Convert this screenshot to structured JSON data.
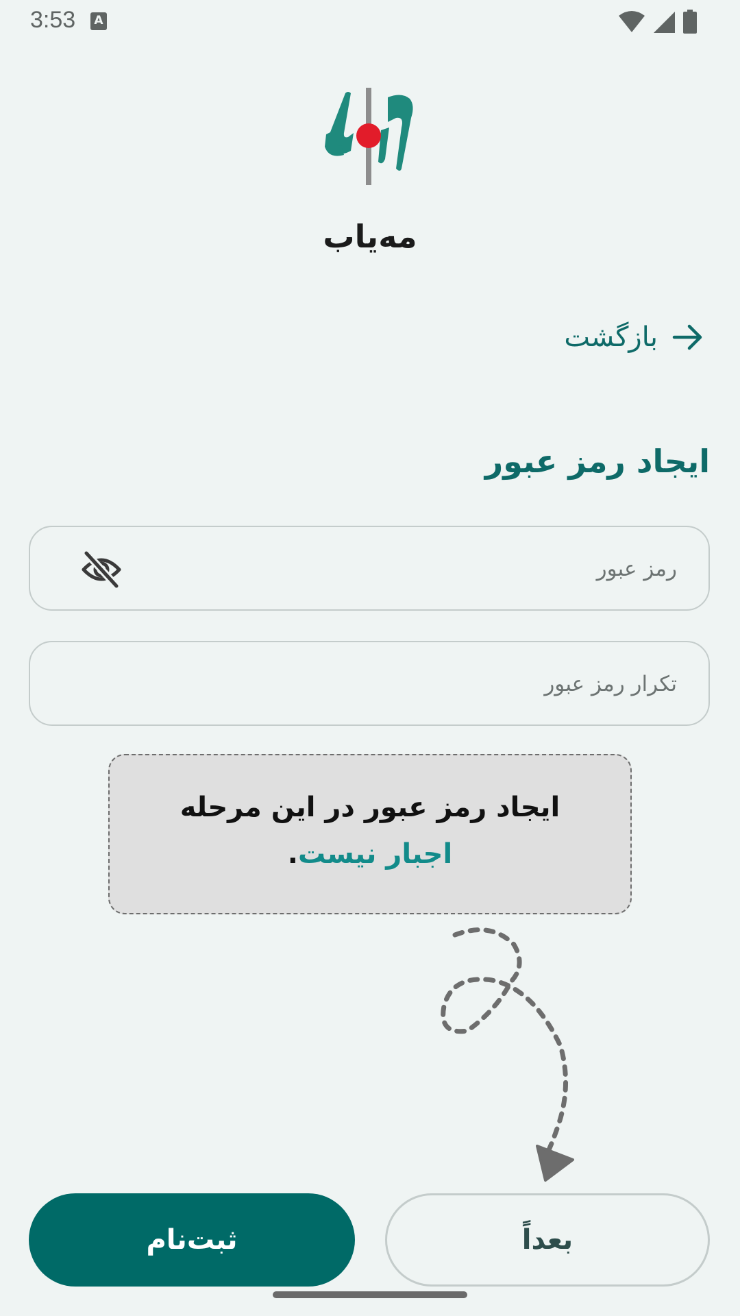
{
  "status_bar": {
    "time": "3:53",
    "notification_icon_letter": "A",
    "icons": [
      "wifi-icon",
      "cellular-signal-icon",
      "battery-icon"
    ]
  },
  "brand": {
    "app_name": "مه‌یاب",
    "logo_icon": "mahyab-logo",
    "colors": {
      "teal": "#1f8a7d",
      "red": "#e21c2a",
      "gray": "#8d8d8d"
    }
  },
  "nav": {
    "back_label": "بازگشت",
    "back_icon": "arrow-right-icon"
  },
  "form": {
    "title": "ایجاد رمز عبور",
    "password_placeholder": "رمز عبور",
    "password_toggle_icon": "eye-off-icon",
    "repeat_placeholder": "تکرار رمز عبور"
  },
  "notice": {
    "line1": "ایجاد رمز عبور در این مرحله",
    "line2_emphasis": "اجبار نیست",
    "line2_suffix": "."
  },
  "actions": {
    "register_label": "ثبت‌نام",
    "later_label": "بعداً"
  },
  "theme": {
    "primary": "#006a67",
    "accent_text": "#0e6a68",
    "background": "#eff4f3",
    "notice_background": "#dfdfdf"
  }
}
